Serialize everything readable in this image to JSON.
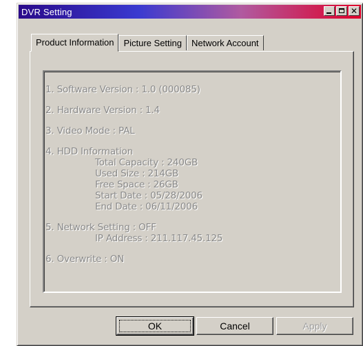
{
  "window": {
    "title": "DVR Setting",
    "titlebar_colors": {
      "left": "#2a0a8a",
      "right": "#e0002a"
    },
    "controls": {
      "minimize": "minimize-icon",
      "maximize": "maximize-icon",
      "close": "close-icon",
      "close_glyph": "✕"
    }
  },
  "tabs": [
    {
      "label": "Product Information",
      "active": true
    },
    {
      "label": "Picture Setting",
      "active": false
    },
    {
      "label": "Network Account",
      "active": false
    }
  ],
  "info": {
    "software_version": "1. Software Version : 1.0 (000085)",
    "hardware_version": "2. Hardware Version : 1.4",
    "video_mode": "3. Video Mode : PAL",
    "hdd_header": "4. HDD Information",
    "hdd": {
      "total_capacity": "Total Capacity : 240GB",
      "used_size": "Used Size : 214GB",
      "free_space": "Free Space : 26GB",
      "start_date": "Start Date : 05/28/2006",
      "end_date": "End Date : 06/11/2006"
    },
    "network_setting": "5. Network Setting : OFF",
    "ip_address": "IP Address : 211.117.45.125",
    "overwrite": "6. Overwrite : ON"
  },
  "buttons": {
    "ok": "OK",
    "cancel": "Cancel",
    "apply": "Apply"
  }
}
